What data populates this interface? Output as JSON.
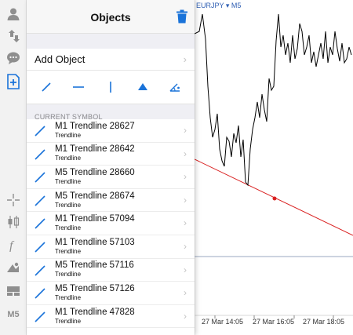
{
  "panel": {
    "title": "Objects",
    "add_object_label": "Add Object",
    "section_label": "CURRENT SYMBOL",
    "trash_icon": "trash-icon",
    "tools": [
      "trendline-tool-icon",
      "horizontal-line-tool-icon",
      "vertical-line-tool-icon",
      "arrow-up-tool-icon",
      "angle-tool-icon"
    ],
    "items": [
      {
        "name": "M1 Trendline 28627",
        "type": "Trendline"
      },
      {
        "name": "M1 Trendline 28642",
        "type": "Trendline"
      },
      {
        "name": "M5 Trendline 28660",
        "type": "Trendline"
      },
      {
        "name": "M5 Trendline 28674",
        "type": "Trendline"
      },
      {
        "name": "M1 Trendline 57094",
        "type": "Trendline"
      },
      {
        "name": "M1 Trendline 57103",
        "type": "Trendline"
      },
      {
        "name": "M5 Trendline 57116",
        "type": "Trendline"
      },
      {
        "name": "M5 Trendline 57126",
        "type": "Trendline"
      },
      {
        "name": "M1 Trendline 47828",
        "type": "Trendline"
      }
    ]
  },
  "chart": {
    "symbol": "EURJPY",
    "timeframe": "M5",
    "x_ticks": [
      "27 Mar 14:05",
      "27 Mar 16:05",
      "27 Mar 18:05"
    ]
  },
  "toolbar": {
    "items": [
      "user-icon",
      "trade-arrows-icon",
      "chat-icon",
      "add-object-icon",
      "crosshair-icon",
      "candlestick-icon",
      "function-icon",
      "objects-icon",
      "templates-icon",
      "timeframe-label"
    ],
    "timeframe_label": "M5"
  },
  "colors": {
    "accent": "#1a73d9",
    "trendline": "#d92020",
    "price_line": "#000000",
    "bid_line": "#9aa7c0",
    "toolbar_icon": "#8e8e8e"
  }
}
